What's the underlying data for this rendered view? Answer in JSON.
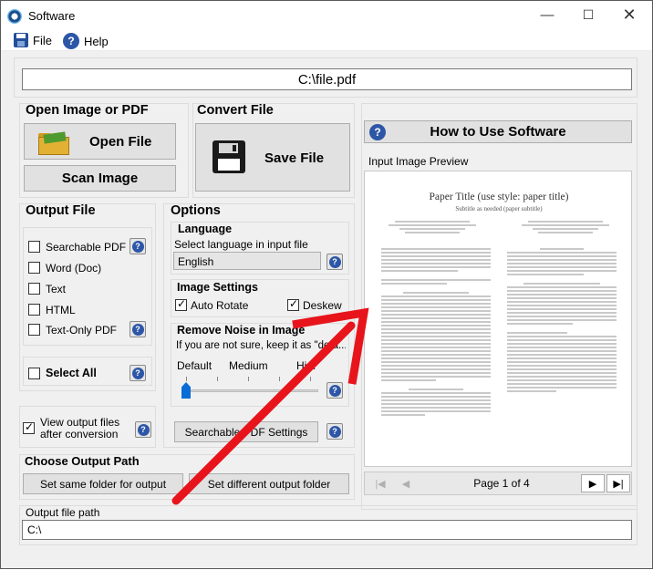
{
  "window": {
    "title": "Software"
  },
  "menu": {
    "file": "File",
    "help": "Help"
  },
  "path_bar": {
    "value": "C:\\file.pdf"
  },
  "open": {
    "heading": "Open Image or PDF",
    "open_file": "Open File",
    "scan_image": "Scan Image"
  },
  "convert": {
    "heading": "Convert File",
    "save_file": "Save File"
  },
  "how_to": {
    "label": "How to Use Software"
  },
  "output_file": {
    "heading": "Output File",
    "options": [
      {
        "label": "Searchable PDF",
        "checked": false
      },
      {
        "label": "Word (Doc)",
        "checked": false
      },
      {
        "label": "Text",
        "checked": false
      },
      {
        "label": "HTML",
        "checked": false
      },
      {
        "label": "Text-Only PDF",
        "checked": false
      }
    ],
    "select_all": "Select All",
    "view_after": "View output files after conversion"
  },
  "options": {
    "heading": "Options",
    "language_heading": "Language",
    "language_prompt": "Select language in input file",
    "language_value": "English",
    "image_settings_heading": "Image Settings",
    "auto_rotate": "Auto Rotate",
    "deskew": "Deskew",
    "noise_heading": "Remove Noise in Image",
    "noise_hint": "If you are not sure, keep it as \"defa...",
    "noise_default": "Default",
    "noise_medium": "Medium",
    "noise_high": "Hi...",
    "searchable_pdf_settings": "Searchable PDF Settings"
  },
  "preview": {
    "heading": "Input Image Preview",
    "doc_title": "Paper Title (use style: paper title)",
    "doc_subtitle": "Subtitle as needed (paper subtitle)",
    "page_indicator": "Page 1 of 4"
  },
  "output_path": {
    "heading": "Choose Output Path",
    "same_folder": "Set same folder for output",
    "different_folder": "Set different output folder",
    "file_path_label": "Output file path",
    "file_path_value": "C:\\"
  },
  "colors": {
    "accent_arrow": "#e8141b",
    "help_blue": "#2d56a7",
    "slider_thumb": "#0a6cd6"
  }
}
